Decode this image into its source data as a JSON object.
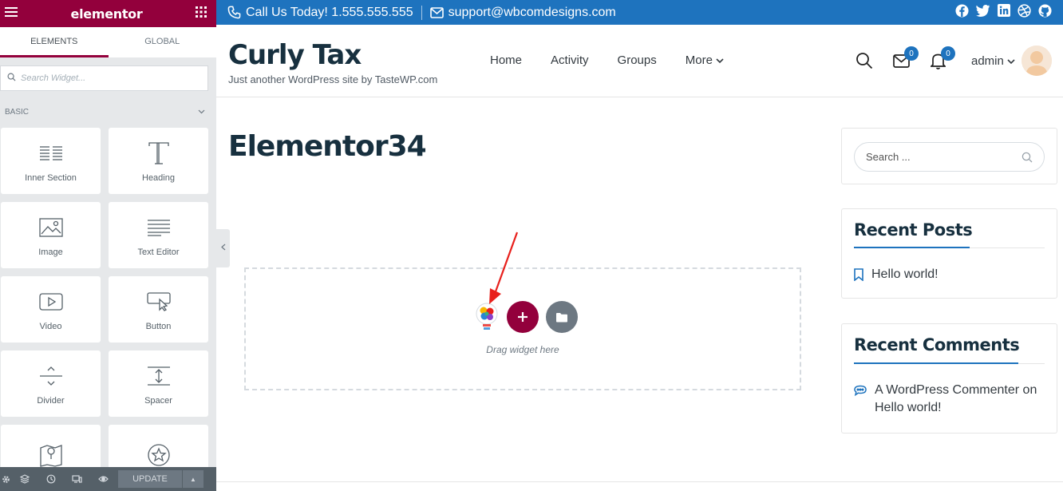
{
  "panel": {
    "brand": "elementor",
    "tabs": [
      {
        "label": "ELEMENTS"
      },
      {
        "label": "GLOBAL"
      }
    ],
    "search_placeholder": "Search Widget...",
    "category": "BASIC",
    "widgets": [
      {
        "label": "Inner Section",
        "icon": "inner-section-icon"
      },
      {
        "label": "Heading",
        "icon": "heading-icon"
      },
      {
        "label": "Image",
        "icon": "image-icon"
      },
      {
        "label": "Text Editor",
        "icon": "text-editor-icon"
      },
      {
        "label": "Video",
        "icon": "video-icon"
      },
      {
        "label": "Button",
        "icon": "button-icon"
      },
      {
        "label": "Divider",
        "icon": "divider-icon"
      },
      {
        "label": "Spacer",
        "icon": "spacer-icon"
      },
      {
        "label": "",
        "icon": "google-maps-icon"
      },
      {
        "label": "",
        "icon": "star-icon"
      }
    ],
    "footer": {
      "update_label": "UPDATE"
    }
  },
  "topbar": {
    "phone": "Call Us Today! 1.555.555.555",
    "email": "support@wbcomdesigns.com"
  },
  "header": {
    "site_title": "Curly Tax",
    "tagline": "Just another WordPress site by TasteWP.com",
    "nav": [
      {
        "label": "Home"
      },
      {
        "label": "Activity"
      },
      {
        "label": "Groups"
      },
      {
        "label": "More"
      }
    ],
    "messages_count": "0",
    "notifications_count": "0",
    "user": "admin"
  },
  "content": {
    "page_title": "Elementor34",
    "drag_text": "Drag widget here"
  },
  "sidebar": {
    "search_placeholder": "Search ...",
    "recent_posts_title": "Recent Posts",
    "recent_posts": [
      {
        "label": "Hello world!"
      }
    ],
    "recent_comments_title": "Recent Comments",
    "recent_comments": [
      {
        "line1": "A WordPress Commenter on",
        "line2": "Hello world!"
      }
    ]
  },
  "colors": {
    "elementor": "#93003c",
    "topbar": "#1e73be",
    "accent": "#1e73be",
    "annotation_arrow": "#e8201c"
  }
}
